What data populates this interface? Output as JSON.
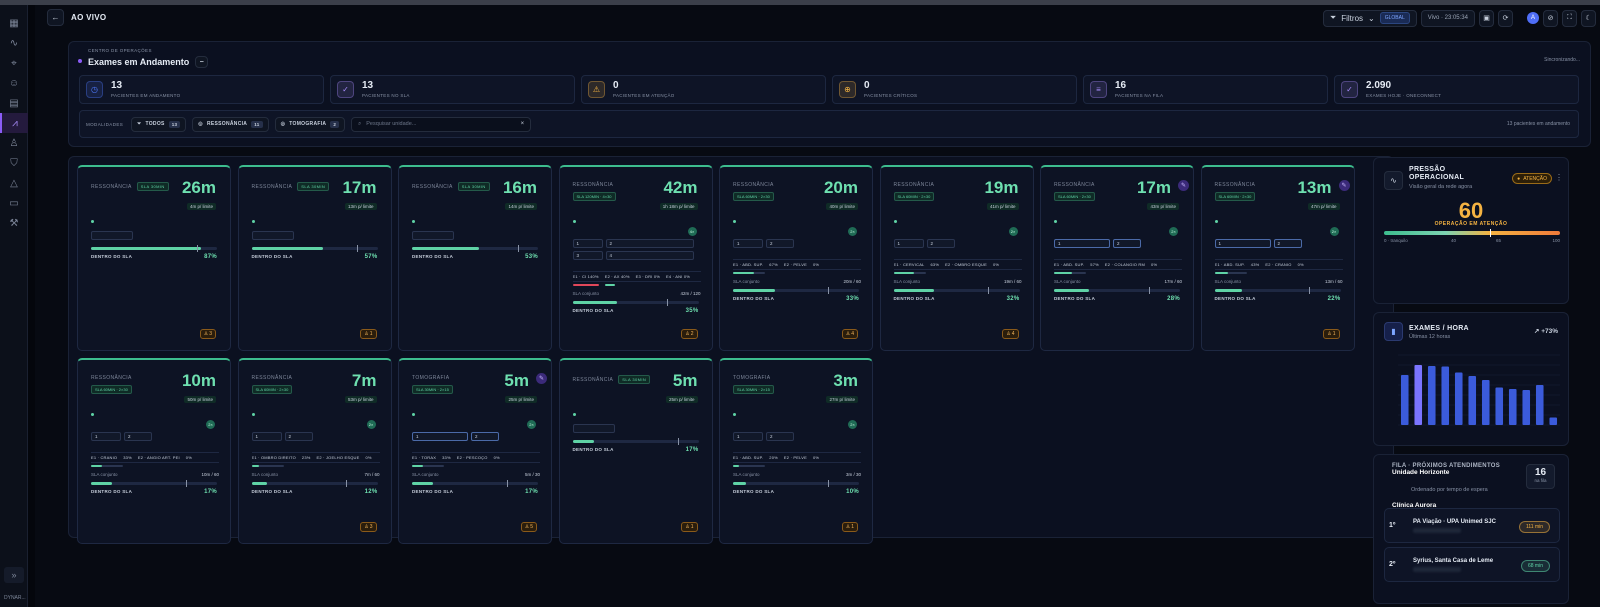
{
  "header": {
    "title": "AO VIVO",
    "filters_label": "Filtros",
    "scope": "GLOBAL",
    "live_time": "Vivo · 23:05:34",
    "avatar_initial": "A"
  },
  "sidebar": {
    "footer": "DYNAR..."
  },
  "ops": {
    "subtitle": "CENTRO DE OPERAÇÕES",
    "title": "Exames em Andamento",
    "sync_status": "Sincronizando...",
    "stats": [
      {
        "value": "13",
        "label": "PACIENTES EM ANDAMENTO",
        "color": "#4f7bff"
      },
      {
        "value": "13",
        "label": "PACIENTES NO SLA",
        "color": "#a78bfa"
      },
      {
        "value": "0",
        "label": "PACIENTES EM ATENÇÃO",
        "color": "#f5b342"
      },
      {
        "value": "0",
        "label": "PACIENTES CRÍTICOS",
        "color": "#f5b342"
      },
      {
        "value": "16",
        "label": "PACIENTES NA FILA",
        "color": "#a78bfa"
      },
      {
        "value": "2.090",
        "label": "EXAMES HOJE · ONECONNECT",
        "color": "#a78bfa"
      }
    ],
    "modalities_label": "MODALIDADES",
    "modalities": [
      {
        "label": "TODOS",
        "count": "13"
      },
      {
        "label": "RESSONÂNCIA",
        "count": "11"
      },
      {
        "label": "TOMOGRAFIA",
        "count": "2"
      }
    ],
    "search_placeholder": "Pesquisar unidade...",
    "count_text": "13 pacientes em andamento"
  },
  "cards": [
    {
      "modality": "RESSONÂNCIA",
      "sla": "SLA 30MIN",
      "time": "26m",
      "limit": "4m p/ limite",
      "dentro": "DENTRO DO SLA",
      "pct": "87%",
      "progress": 87,
      "patients": "3"
    },
    {
      "modality": "RESSONÂNCIA",
      "sla": "SLA 30MIN",
      "time": "17m",
      "limit": "13m p/ limite",
      "dentro": "DENTRO DO SLA",
      "pct": "57%",
      "progress": 57,
      "patients": "1"
    },
    {
      "modality": "RESSONÂNCIA",
      "sla": "SLA 30MIN",
      "time": "16m",
      "limit": "14m p/ limite",
      "dentro": "DENTRO DO SLA",
      "pct": "53%",
      "progress": 53
    },
    {
      "modality": "RESSONÂNCIA",
      "sla": "SLA 120MIN · 4×30",
      "time": "42m",
      "limit": "1h 18m p/ limite",
      "badge": "4×",
      "slots": [
        [
          "1",
          "2"
        ],
        [
          "3",
          "4"
        ]
      ],
      "exams": [
        "E1 · CI 140%",
        "E2 · AX 40%",
        "E3 · DRI 0%",
        "E4 · ANI 0%"
      ],
      "sla_conjunto": "SLA conjunto",
      "sla_value": "42m / 120",
      "dentro": "DENTRO DO SLA",
      "pct": "35%",
      "progress": 35,
      "patients": "2"
    },
    {
      "modality": "RESSONÂNCIA",
      "sla": "SLA 60MIN · 2×30",
      "time": "20m",
      "limit": "40m p/ limite",
      "badge": "2×",
      "slots": [
        [
          "1",
          "2"
        ]
      ],
      "exams": [
        "E1 · ABD. SUP.",
        "67%",
        "E2 · PELVE",
        "0%"
      ],
      "sla_conjunto": "SLA conjunto",
      "sla_value": "20m / 60",
      "dentro": "DENTRO DO SLA",
      "pct": "33%",
      "progress": 33,
      "patients": "4"
    },
    {
      "modality": "RESSONÂNCIA",
      "sla": "SLA 60MIN · 2×30",
      "time": "19m",
      "limit": "41m p/ limite",
      "badge": "2×",
      "slots": [
        [
          "1",
          "2"
        ]
      ],
      "exams": [
        "E1 · CERVICAL",
        "63%",
        "E2 · OMBRO ESQUE",
        "0%"
      ],
      "sla_conjunto": "SLA conjunto",
      "sla_value": "19m / 60",
      "dentro": "DENTRO DO SLA",
      "pct": "32%",
      "progress": 32,
      "patients": "4"
    },
    {
      "modality": "RESSONÂNCIA",
      "sla": "SLA 60MIN · 2×30",
      "time": "17m",
      "limit": "43m p/ limite",
      "badge": "2×",
      "edit": true,
      "slots": [
        [
          "1",
          "2"
        ]
      ],
      "exams": [
        "E1 · ABD. SUP.",
        "57%",
        "E2 · COLANGIO RM",
        "0%"
      ],
      "sla_conjunto": "SLA conjunto",
      "sla_value": "17m / 60",
      "dentro": "DENTRO DO SLA",
      "pct": "28%",
      "progress": 28
    },
    {
      "modality": "RESSONÂNCIA",
      "sla": "SLA 60MIN · 2×30",
      "time": "13m",
      "limit": "47m p/ limite",
      "badge": "2×",
      "edit": true,
      "slots": [
        [
          "1",
          "2"
        ]
      ],
      "exams": [
        "E1 · ABD. SUP.",
        "43%",
        "E2 · CRANIO",
        "0%"
      ],
      "sla_conjunto": "SLA conjunto",
      "sla_value": "13m / 60",
      "dentro": "DENTRO DO SLA",
      "pct": "22%",
      "progress": 22,
      "patients": "1"
    },
    {
      "modality": "RESSONÂNCIA",
      "sla": "SLA 60MIN · 2×30",
      "time": "10m",
      "limit": "50m p/ limite",
      "badge": "2×",
      "slots": [
        [
          "1",
          "2"
        ]
      ],
      "exams": [
        "E1 · CRANIO",
        "33%",
        "E2 · ANGIO ART. PEI",
        "0%"
      ],
      "sla_conjunto": "SLA conjunto",
      "sla_value": "10m / 60",
      "dentro": "DENTRO DO SLA",
      "pct": "17%",
      "progress": 17
    },
    {
      "modality": "RESSONÂNCIA",
      "sla": "SLA 60MIN · 2×30",
      "time": "7m",
      "limit": "53m p/ limite",
      "badge": "2×",
      "slots": [
        [
          "1",
          "2"
        ]
      ],
      "exams": [
        "E1 · OMBRO DIREITO",
        "23%",
        "E2 · JOELHO ESQUE",
        "0%"
      ],
      "sla_conjunto": "SLA conjunto",
      "sla_value": "7m / 60",
      "dentro": "DENTRO DO SLA",
      "pct": "12%",
      "progress": 12,
      "patients": "3"
    },
    {
      "modality": "TOMOGRAFIA",
      "sla": "SLA 30MIN · 2×15",
      "time": "5m",
      "limit": "25m p/ limite",
      "badge": "2×",
      "edit": true,
      "slots": [
        [
          "1",
          "2"
        ]
      ],
      "exams": [
        "E1 · TORAX",
        "33%",
        "E2 · PESCOÇO",
        "0%"
      ],
      "sla_conjunto": "SLA conjunto",
      "sla_value": "5m / 30",
      "dentro": "DENTRO DO SLA",
      "pct": "17%",
      "progress": 17,
      "patients": "5"
    },
    {
      "modality": "RESSONÂNCIA",
      "sla": "SLA 30MIN",
      "time": "5m",
      "limit": "25m p/ limite",
      "dentro": "DENTRO DO SLA",
      "pct": "17%",
      "progress": 17,
      "patients": "1"
    },
    {
      "modality": "TOMOGRAFIA",
      "sla": "SLA 30MIN · 2×15",
      "time": "3m",
      "limit": "27m p/ limite",
      "badge": "2×",
      "slots": [
        [
          "1",
          "2"
        ]
      ],
      "exams": [
        "E1 · ABD. SUP.",
        "20%",
        "E2 · PELVE",
        "0%"
      ],
      "sla_conjunto": "SLA conjunto",
      "sla_value": "3m / 30",
      "dentro": "DENTRO DO SLA",
      "pct": "10%",
      "progress": 10,
      "patients": "1"
    }
  ],
  "pressao": {
    "title": "PRESSÃO OPERACIONAL",
    "subtitle": "Visão geral da rede agora",
    "status": "ATENÇÃO",
    "value": "60",
    "gauge_value": 60,
    "label": "OPERAÇÃO EM ATENÇÃO",
    "scale": [
      "0 · tranquilo",
      "40",
      "65",
      "100"
    ]
  },
  "exames_hora": {
    "title": "EXAMES / HORA",
    "subtitle": "Últimas 12 horas",
    "delta": "↗ +73%"
  },
  "fila": {
    "title": "FILA · PRÓXIMOS ATENDIMENTOS",
    "unit": "Unidade Horizonte",
    "subtitle": "Ordenado por tempo de espera",
    "count": "16",
    "count_label": "na fila",
    "clinic": "Clínica Aurora",
    "items": [
      {
        "pos": "1º",
        "name": "PA Viação · UPA Unimed SJC",
        "time": "111 min",
        "color": "#f5b342"
      },
      {
        "pos": "2º",
        "name": "Syrius, Santa Casa de Leme",
        "time": "68 min",
        "color": "#5fd3a6"
      }
    ]
  },
  "chart_data": {
    "type": "bar",
    "title": "EXAMES / HORA",
    "subtitle": "Últimas 12 horas",
    "categories": [
      "",
      "",
      "",
      "",
      "",
      "",
      "",
      "",
      "",
      "",
      "",
      ""
    ],
    "values": [
      100,
      120,
      118,
      117,
      105,
      98,
      90,
      75,
      72,
      70,
      80,
      15
    ],
    "ylim": [
      0,
      140
    ],
    "grid": true,
    "highlight_index": 1
  }
}
